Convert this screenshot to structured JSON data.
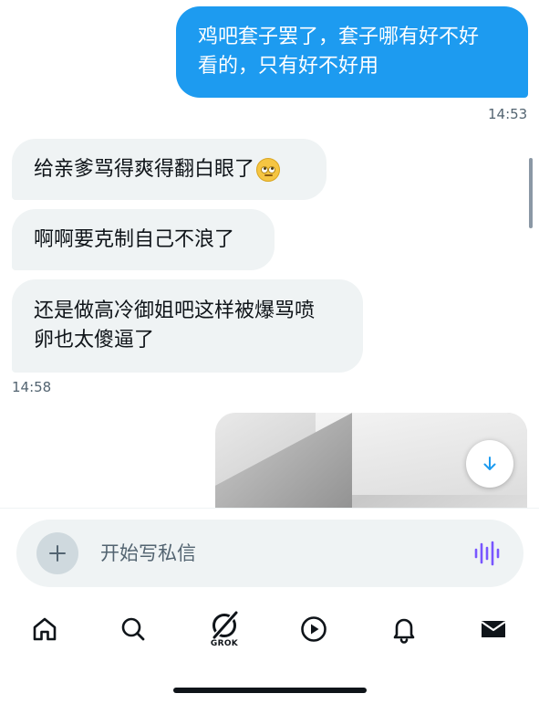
{
  "messages": [
    {
      "dir": "out",
      "text": "鸡吧套子罢了，套子哪有好不好\n看的，只有好不好用",
      "time": "14:53"
    },
    {
      "dir": "in",
      "text": "给亲爹骂得爽得翻白眼了",
      "emoji": "face-with-rolling-eyes-icon"
    },
    {
      "dir": "in",
      "text": "啊啊要克制自己不浪了"
    },
    {
      "dir": "in",
      "text": "还是做高冷御姐吧这样被爆骂喷\n卵也太傻逼了",
      "time": "14:58"
    }
  ],
  "composer": {
    "placeholder": "开始写私信",
    "add_icon": "plus-icon",
    "voice_icon": "voice-waveform-icon",
    "accent": "#7856ff"
  },
  "scroll_down_icon": "arrow-down-icon",
  "tabbar": {
    "items": [
      {
        "id": "home",
        "icon": "home-icon"
      },
      {
        "id": "search",
        "icon": "search-icon"
      },
      {
        "id": "grok",
        "icon": "grok-icon",
        "label": "GROK"
      },
      {
        "id": "video",
        "icon": "play-icon"
      },
      {
        "id": "notifications",
        "icon": "bell-icon"
      },
      {
        "id": "messages",
        "icon": "mail-icon",
        "active": true
      }
    ]
  },
  "colors": {
    "outgoing_bubble": "#1d9bf0",
    "incoming_bubble": "#eff3f4",
    "timestamp": "#536471",
    "scroll_arrow": "#1d9bf0"
  }
}
